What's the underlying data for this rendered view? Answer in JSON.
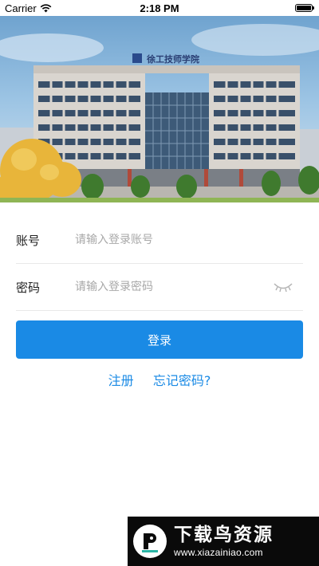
{
  "status_bar": {
    "carrier": "Carrier",
    "time": "2:18 PM",
    "battery_level": 1.0,
    "wifi_icon": "wifi-icon",
    "battery_icon": "battery-icon"
  },
  "banner": {
    "building_sign": "徐工技师学院"
  },
  "form": {
    "account_label": "账号",
    "account_placeholder": "请输入登录账号",
    "account_value": "",
    "password_label": "密码",
    "password_placeholder": "请输入登录密码",
    "password_value": "",
    "password_visibility_icon": "eye-closed-icon"
  },
  "login_button_label": "登录",
  "links": {
    "register": "注册",
    "forgot_password": "忘记密码?"
  },
  "watermark": {
    "title": "下载鸟资源",
    "url": "www.xiazainiao.com"
  },
  "colors": {
    "accent": "#1a8ae5",
    "placeholder": "#a8a8a8",
    "divider": "#e8e8e8"
  }
}
